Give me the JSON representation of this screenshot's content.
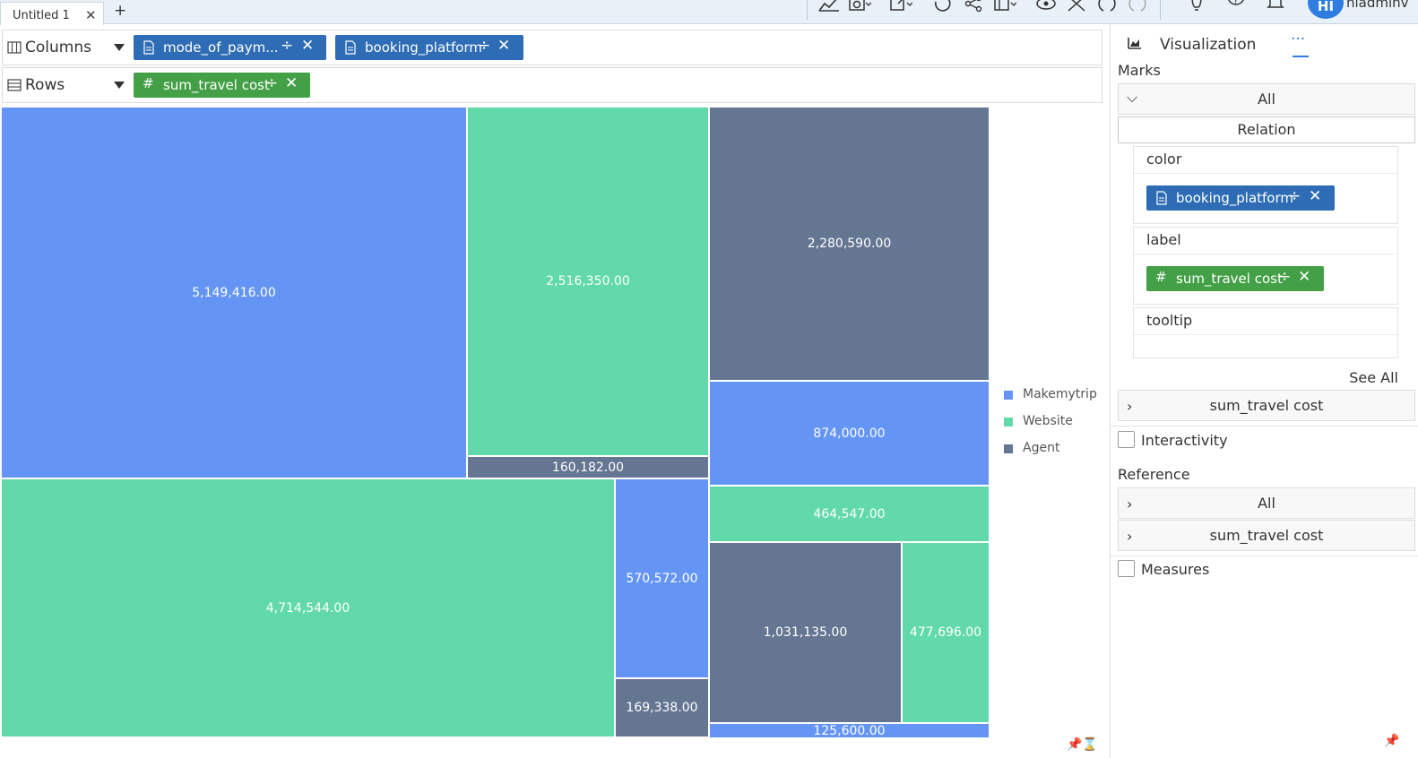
{
  "tab": {
    "title": "Untitled 1",
    "close": "✕",
    "add": "+"
  },
  "user": {
    "initials": "HI",
    "name": "hiadminv"
  },
  "columns_shelf": {
    "label": "Columns",
    "pills": [
      {
        "label": "mode_of_paym...",
        "divide": "÷",
        "close": "✕"
      },
      {
        "label": "booking_platform",
        "divide": "÷",
        "close": "✕"
      }
    ]
  },
  "rows_shelf": {
    "label": "Rows",
    "pills": [
      {
        "label": "sum_travel cost",
        "divide": "÷",
        "close": "✕"
      }
    ]
  },
  "chart_data": {
    "type": "treemap",
    "series_colors": {
      "Makemytrip": "#6495f5",
      "Website": "#62d9ab",
      "Agent": "#657693"
    },
    "legend": [
      "Makemytrip",
      "Website",
      "Agent"
    ],
    "legend_position": "right",
    "tiles": [
      {
        "platform": "Makemytrip",
        "value": 5149416,
        "label": "5,149,416.00"
      },
      {
        "platform": "Website",
        "value": 2516350,
        "label": "2,516,350.00"
      },
      {
        "platform": "Agent",
        "value": 160182,
        "label": "160,182.00"
      },
      {
        "platform": "Agent",
        "value": 2280590,
        "label": "2,280,590.00"
      },
      {
        "platform": "Makemytrip",
        "value": 874000,
        "label": "874,000.00"
      },
      {
        "platform": "Website",
        "value": 464547,
        "label": "464,547.00"
      },
      {
        "platform": "Website",
        "value": 4714544,
        "label": "4,714,544.00"
      },
      {
        "platform": "Makemytrip",
        "value": 570572,
        "label": "570,572.00"
      },
      {
        "platform": "Agent",
        "value": 169338,
        "label": "169,338.00"
      },
      {
        "platform": "Agent",
        "value": 1031135,
        "label": "1,031,135.00"
      },
      {
        "platform": "Website",
        "value": 477696,
        "label": "477,696.00"
      },
      {
        "platform": "Makemytrip",
        "value": 125600,
        "label": "125,600.00"
      }
    ]
  },
  "panel": {
    "tab_label": "Visualization",
    "more": "···",
    "marks_title": "Marks",
    "marks_all": "All",
    "relation": "Relation",
    "color_title": "color",
    "color_pill": "booking_platform",
    "label_title": "label",
    "label_pill": "sum_travel cost",
    "tooltip_title": "tooltip",
    "pill_divide": "÷",
    "pill_close": "✕",
    "see_all": "See All",
    "measure_row": "sum_travel cost",
    "interactivity": "Interactivity",
    "reference_title": "Reference",
    "reference_all": "All",
    "reference_measure": "sum_travel cost",
    "measures": "Measures",
    "chevron_down": "⌵",
    "chevron_right": "›"
  }
}
